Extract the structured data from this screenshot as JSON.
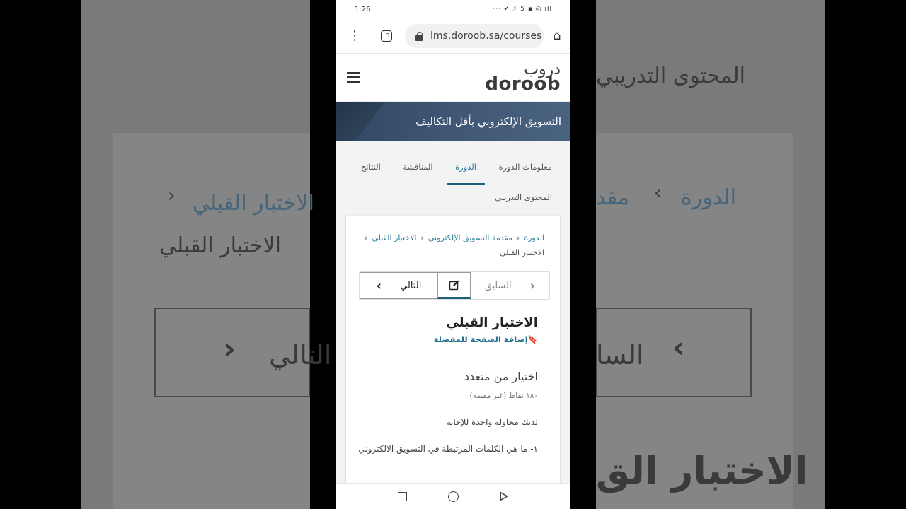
{
  "status_bar": {
    "time": "1:26",
    "icons_text": "··· ✔ ⚡ 5 ▪ ◎ ıll"
  },
  "browser": {
    "url": "lms.doroob.sa/courses",
    "tab_count": ":D"
  },
  "site": {
    "logo_ar": "دروب",
    "logo_en": "doroob"
  },
  "banner": {
    "title": "التسويق الإلكتروني بأقل التكاليف"
  },
  "tabs": [
    {
      "label": "معلومات الدورة"
    },
    {
      "label": "الدورة"
    },
    {
      "label": "المناقشة"
    },
    {
      "label": "النتائج"
    }
  ],
  "subnav": {
    "label": "المحتوى التدريبي"
  },
  "breadcrumb": {
    "item1": "الدورة",
    "item2": "مقدمة التسويق الإلكتروني",
    "item3": "الاختبار القبلي",
    "current": "الاختبار القبلي"
  },
  "nav_buttons": {
    "next": "التالي",
    "previous": "السابق"
  },
  "question": {
    "title": "الاختبار القبلي",
    "bookmark": "إضافة الصفحة للمفضلة",
    "type": "اختيار من متعدد",
    "points": "١٨٠ نقاط (غير مقيمة)",
    "attempts": "لديك محاولة واحدة للإجابة",
    "text": "١- ما هي الكلمات المرتبطة في التسويق الالكتروني"
  },
  "background_mirror": {
    "left_heading": "المحتوى التدريبي",
    "left_crumb1": "الدورة",
    "left_crumb2": "مقد",
    "left_crumb3": "الاختبار القبلي",
    "left_title": "الاختبار القبلي",
    "left_next": "التالي",
    "right_heading": "المحتوى التدري",
    "right_prev": "السا",
    "right_title": "الاختبار الق"
  }
}
